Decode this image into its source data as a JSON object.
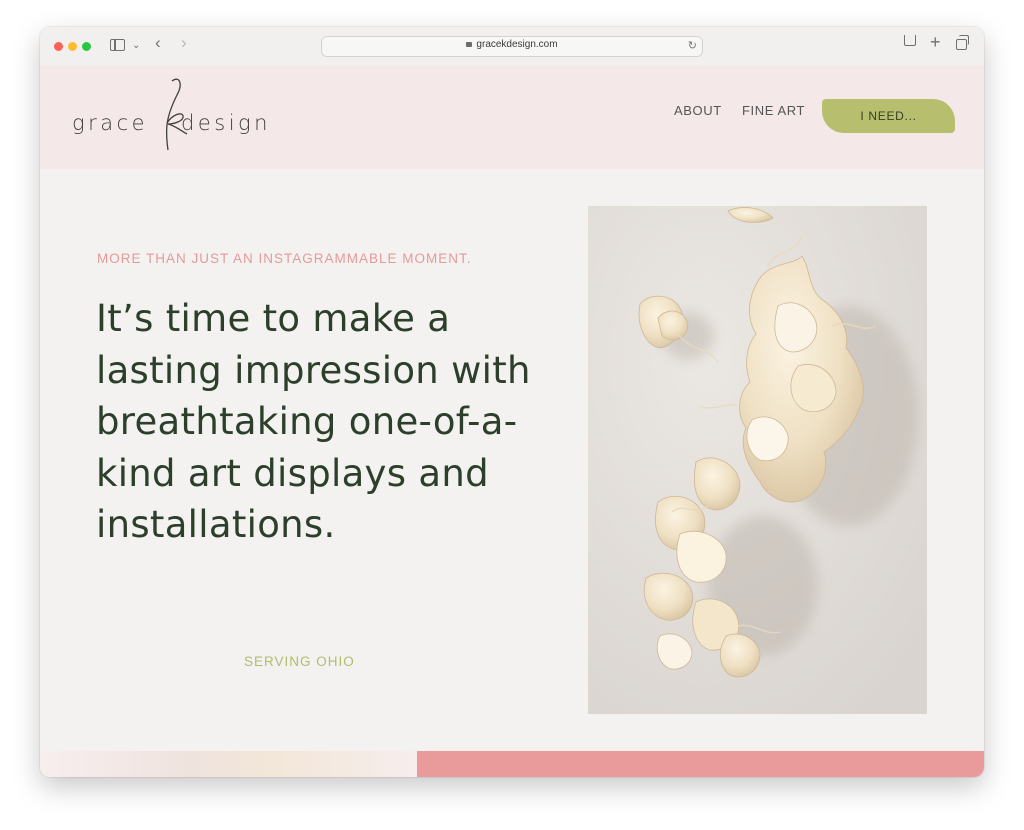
{
  "browser": {
    "url": "gracekdesign.com"
  },
  "site": {
    "logo": {
      "left": "grace",
      "right": "design"
    },
    "nav": {
      "about": "ABOUT",
      "fine_art": "FINE ART",
      "cta": "I NEED..."
    }
  },
  "hero": {
    "eyebrow": "MORE THAN JUST AN INSTAGRAMMABLE MOMENT.",
    "headline": "It’s time to make a lasting impression with breathtaking one-of-a-kind art displays and installations.",
    "serving": "SERVING OHIO"
  },
  "colors": {
    "header_bg": "#f5e8e8",
    "page_bg": "#f3f2f0",
    "accent_green": "#b7bf6e",
    "accent_pink": "#e59a9a",
    "headline": "#2c3f2a",
    "strip_pink": "#e99b9c"
  },
  "icons": {
    "window_controls": [
      "close-dot",
      "minimize-dot",
      "zoom-dot"
    ],
    "toolbar": [
      "sidebar-icon",
      "chevron-down-icon",
      "back-icon",
      "forward-icon",
      "lock-icon",
      "reload-icon",
      "share-icon",
      "new-tab-icon",
      "tab-overview-icon"
    ]
  }
}
